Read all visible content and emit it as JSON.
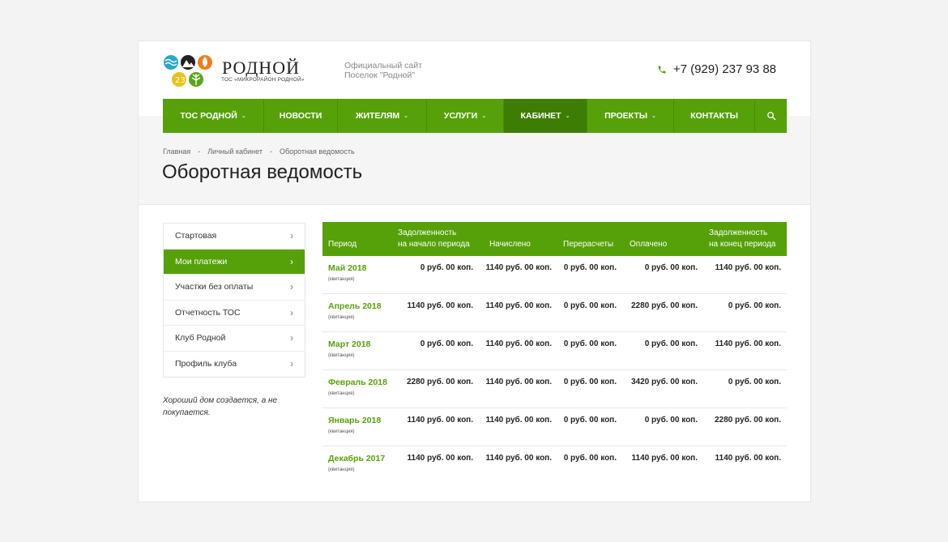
{
  "header": {
    "logo_title": "РОДНОЙ",
    "logo_subtitle": "ТОС «МИКРОРАЙОН РОДНОЙ»",
    "tagline_line1": "Официальный сайт",
    "tagline_line2": "Поселок \"Родной\"",
    "phone": "+7 (929) 237 93 88"
  },
  "nav": {
    "items": [
      {
        "label": "ТОС РОДНОЙ",
        "has_dropdown": true
      },
      {
        "label": "НОВОСТИ",
        "has_dropdown": false
      },
      {
        "label": "ЖИТЕЛЯМ",
        "has_dropdown": true
      },
      {
        "label": "УСЛУГИ",
        "has_dropdown": true
      },
      {
        "label": "КАБИНЕТ",
        "has_dropdown": true,
        "active": true
      },
      {
        "label": "ПРОЕКТЫ",
        "has_dropdown": true
      },
      {
        "label": "КОНТАКТЫ",
        "has_dropdown": false
      }
    ],
    "search_icon": "search-icon"
  },
  "breadcrumb": {
    "items": [
      "Главная",
      "Личный кабинет",
      "Оборотная ведомость"
    ],
    "separator": "-"
  },
  "page_title": "Оборотная ведомость",
  "sidebar": {
    "items": [
      {
        "label": "Стартовая"
      },
      {
        "label": "Мои платежи",
        "active": true
      },
      {
        "label": "Участки без оплаты"
      },
      {
        "label": "Отчетность ТОС"
      },
      {
        "label": "Клуб Родной"
      },
      {
        "label": "Профиль клуба"
      }
    ],
    "quote": "Хороший дом создается, а не покупается."
  },
  "table": {
    "headers": {
      "period": "Период",
      "debt_start_1": "Задолженность",
      "debt_start_2": "на начало периода",
      "charged": "Начислено",
      "recalc": "Перерасчеты",
      "paid": "Оплачено",
      "debt_end_1": "Задолженность",
      "debt_end_2": "на конец периода"
    },
    "receipt_label": "(квитанция)",
    "rows": [
      {
        "period": "Май 2018",
        "debt_start": "0 руб. 00 коп.",
        "charged": "1140 руб. 00 коп.",
        "recalc": "0 руб. 00 коп.",
        "paid": "0 руб. 00 коп.",
        "debt_end": "1140 руб. 00 коп."
      },
      {
        "period": "Апрель 2018",
        "debt_start": "1140 руб. 00 коп.",
        "charged": "1140 руб. 00 коп.",
        "recalc": "0 руб. 00 коп.",
        "paid": "2280 руб. 00 коп.",
        "debt_end": "0 руб. 00 коп."
      },
      {
        "period": "Март 2018",
        "debt_start": "0 руб. 00 коп.",
        "charged": "1140 руб. 00 коп.",
        "recalc": "0 руб. 00 коп.",
        "paid": "0 руб. 00 коп.",
        "debt_end": "1140 руб. 00 коп."
      },
      {
        "period": "Февраль 2018",
        "debt_start": "2280 руб. 00 коп.",
        "charged": "1140 руб. 00 коп.",
        "recalc": "0 руб. 00 коп.",
        "paid": "3420 руб. 00 коп.",
        "debt_end": "0 руб. 00 коп."
      },
      {
        "period": "Январь 2018",
        "debt_start": "1140 руб. 00 коп.",
        "charged": "1140 руб. 00 коп.",
        "recalc": "0 руб. 00 коп.",
        "paid": "0 руб. 00 коп.",
        "debt_end": "2280 руб. 00 коп."
      },
      {
        "period": "Декабрь 2017",
        "debt_start": "1140 руб. 00 коп.",
        "charged": "1140 руб. 00 коп.",
        "recalc": "0 руб. 00 коп.",
        "paid": "1140 руб. 00 коп.",
        "debt_end": "1140 руб. 00 коп."
      }
    ]
  },
  "colors": {
    "brand_green": "#56a10a",
    "nav_active": "#3d7d03",
    "background": "#f3f3f3"
  }
}
